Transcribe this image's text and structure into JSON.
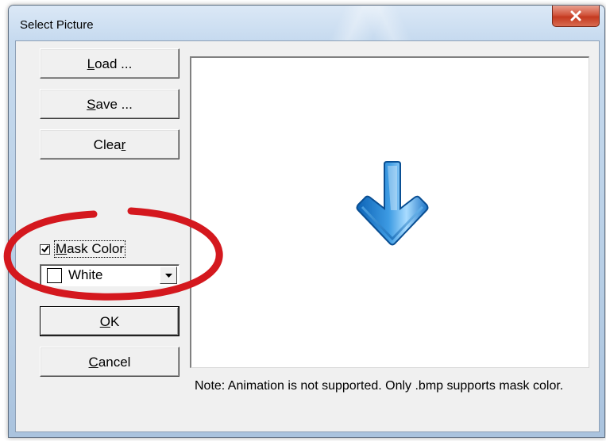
{
  "window": {
    "title": "Select Picture"
  },
  "buttons": {
    "load_prefix": "",
    "load_mnemonic": "L",
    "load_rest": "oad ...",
    "save_mnemonic": "S",
    "save_rest": "ave ...",
    "clear_prefix": "Clea",
    "clear_mnemonic": "r",
    "ok_mnemonic": "O",
    "ok_rest": "K",
    "cancel_mnemonic": "C",
    "cancel_rest": "ancel"
  },
  "mask": {
    "checked": true,
    "label_mnemonic": "M",
    "label_rest": "ask Color",
    "color_selected": "White",
    "swatch_color": "#ffffff"
  },
  "preview": {
    "image_icon": "arrow-down-icon",
    "note": "Note: Animation is not supported. Only .bmp supports mask color."
  },
  "annotation": {
    "highlight_color": "#d4181e"
  }
}
